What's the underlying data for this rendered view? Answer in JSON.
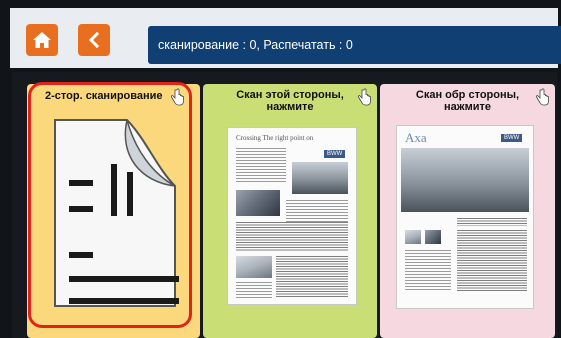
{
  "header": {
    "home_icon": "home-icon",
    "back_icon": "back-arrow-icon",
    "status_text": "сканирование : 0, Распечатать : 0",
    "accent_color": "#e96f20",
    "status_bar_color": "#0f3f73"
  },
  "cards": [
    {
      "title": "2-стор. сканирование",
      "icon": "duplex-document-icon",
      "background": "#fbd87c",
      "selected": true
    },
    {
      "title_line1": "Скан этой стороны,",
      "title_line2": "нажмите",
      "background": "#c9de74",
      "preview": {
        "headline": "Crossing The right point on",
        "brand": "BWW"
      }
    },
    {
      "title_line1": "Скан обр стороны,",
      "title_line2": "нажмите",
      "background": "#f6d8e1",
      "preview": {
        "brand_large": "Axa",
        "brand": "BWW"
      }
    }
  ],
  "highlight_color": "#e2231a"
}
